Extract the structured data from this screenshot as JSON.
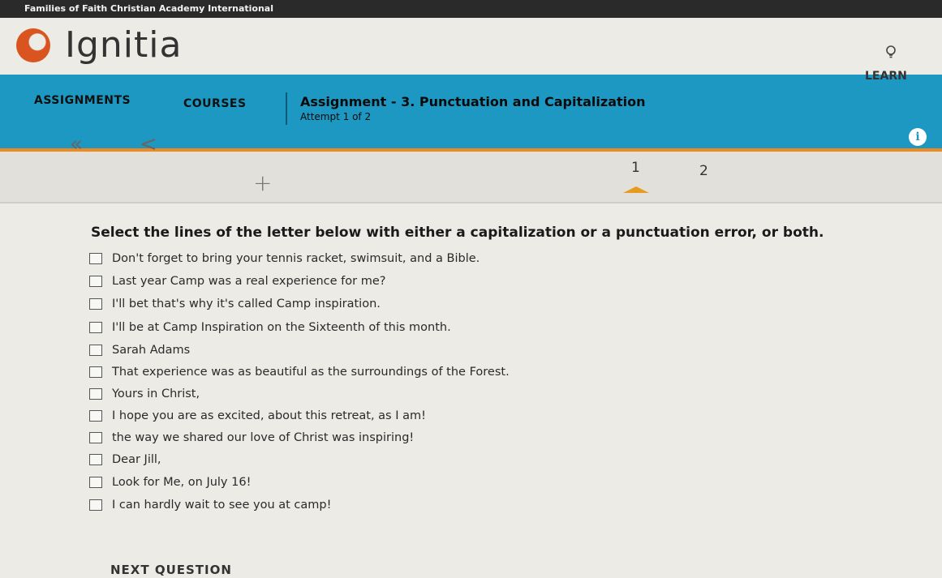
{
  "window": {
    "title": "Families of Faith Christian Academy International"
  },
  "header": {
    "logo_text": "Ignitia",
    "learn_label": "LEARN"
  },
  "nav": {
    "assignments": "ASSIGNMENTS",
    "courses": "COURSES",
    "assignment_title": "Assignment - 3. Punctuation and Capitalization",
    "attempt": "Attempt 1 of 2"
  },
  "subnav": {
    "first_label": "«",
    "prev_label": "<",
    "add_label": "+",
    "questions": [
      "1",
      "2"
    ],
    "active_question": 1
  },
  "question": {
    "prompt": "Select the lines of the letter below with either a capitalization or a punctuation error, or both.",
    "options": [
      "Don't forget to bring your tennis racket, swimsuit, and a Bible.",
      "Last year Camp was a real experience for me?",
      "I'll bet that's why it's called Camp inspiration.",
      "I'll be at Camp Inspiration on the Sixteenth of this month.",
      "Sarah Adams",
      "That experience was as beautiful as the surroundings of the Forest.",
      "Yours in Christ,",
      "I hope you are as excited, about this retreat, as I am!",
      "the way we shared our love of Christ was inspiring!",
      "Dear Jill,",
      "Look for Me, on July 16!",
      "I can hardly wait to see you at camp!"
    ]
  },
  "footer": {
    "next_label": "NEXT QUESTION"
  },
  "colors": {
    "nav_blue": "#1d98c2",
    "accent_orange": "#f08a20",
    "logo_orange": "#d9541e"
  }
}
